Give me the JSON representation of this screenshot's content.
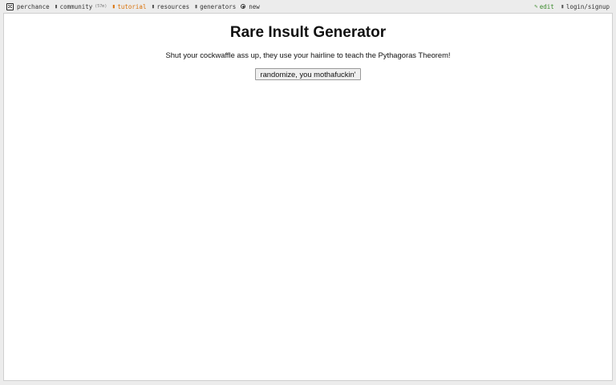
{
  "topbar": {
    "brand": "perchance",
    "community": "community",
    "community_count": "(57m)",
    "tutorial": "tutorial",
    "resources": "resources",
    "generators": "generators",
    "new": "new",
    "edit": "edit",
    "login": "login/signup"
  },
  "icons": {
    "brand": "dice-icon",
    "community": "chat-icon",
    "tutorial": "book-icon",
    "resources": "folder-icon",
    "generators": "list-icon",
    "new": "plus-icon",
    "edit": "pencil-icon",
    "login": "user-icon"
  },
  "colors": {
    "tutorial": "#d9720a",
    "edit": "#3a8a2a",
    "background": "#ececec",
    "panel": "#ffffff"
  },
  "page": {
    "title": "Rare Insult Generator",
    "output": "Shut your cockwaffle ass up, they use your hairline to teach the Pythagoras Theorem!",
    "button_label": "randomize, you mothafuckin'"
  }
}
